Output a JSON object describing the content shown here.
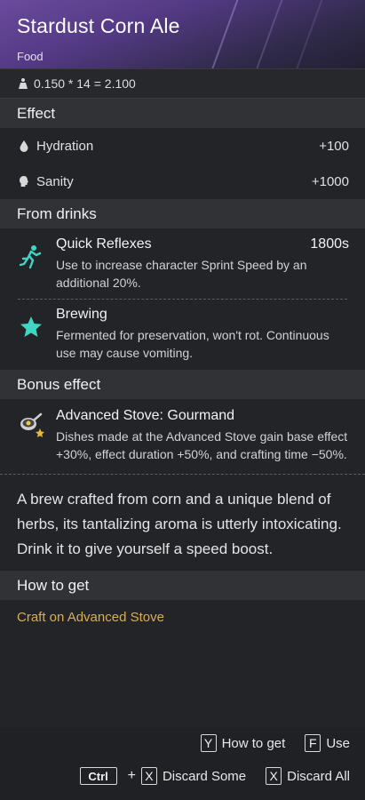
{
  "item": {
    "name": "Stardust Corn Ale",
    "category": "Food",
    "weight_formula": "0.150 * 14 = 2.100"
  },
  "effect": {
    "heading": "Effect",
    "stats": [
      {
        "label": "Hydration",
        "value": "+100",
        "icon": "droplet-icon"
      },
      {
        "label": "Sanity",
        "value": "+1000",
        "icon": "head-icon"
      }
    ]
  },
  "drinks": {
    "heading": "From drinks",
    "buffs": [
      {
        "name": "Quick Reflexes",
        "duration": "1800s",
        "desc": "Use to increase character Sprint Speed by an additional 20%.",
        "icon": "running-man-icon"
      },
      {
        "name": "Brewing",
        "duration": "",
        "desc": "Fermented for preservation, won't rot. Continuous use may cause vomiting.",
        "icon": "star-icon"
      }
    ]
  },
  "bonus": {
    "heading": "Bonus effect",
    "name": "Advanced Stove: Gourmand",
    "desc": "Dishes made at the Advanced Stove gain base effect +30%, effect duration +50%, and crafting time −50%.",
    "icon": "frying-pan-icon"
  },
  "description": "A brew crafted from corn and a unique blend of herbs, its tantalizing aroma is utterly intoxicating. Drink it to give yourself a speed boost.",
  "how_to_get": {
    "heading": "How to get",
    "source": "Craft on Advanced Stove"
  },
  "footer": {
    "how_to_get_key": "Y",
    "how_to_get_label": "How to get",
    "use_key": "F",
    "use_label": "Use",
    "ctrl_key": "Ctrl",
    "plus": "+",
    "discard_some_key": "X",
    "discard_some_label": "Discard Some",
    "discard_all_key": "X",
    "discard_all_label": "Discard All"
  },
  "colors": {
    "header_purple": "#5a3d8c",
    "source_gold": "#d8ae55",
    "buff_cyan": "#3fd6c4"
  }
}
